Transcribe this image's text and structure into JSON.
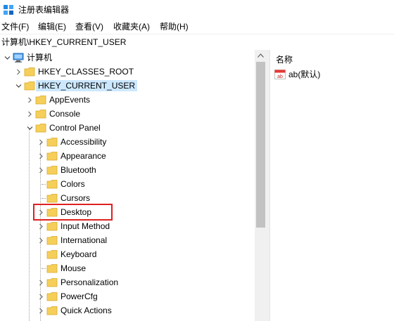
{
  "window": {
    "title": "注册表编辑器",
    "icon": "regedit-icon"
  },
  "menu": [
    "文件(F)",
    "编辑(E)",
    "查看(V)",
    "收藏夹(A)",
    "帮助(H)"
  ],
  "address": "计算机\\HKEY_CURRENT_USER",
  "tree": {
    "root": "计算机",
    "hkcr": "HKEY_CLASSES_ROOT",
    "hkcu": "HKEY_CURRENT_USER",
    "hkcu_children": [
      "AppEvents",
      "Console",
      "Control Panel"
    ],
    "control_panel_children": [
      "Accessibility",
      "Appearance",
      "Bluetooth",
      "Colors",
      "Cursors",
      "Desktop",
      "Input Method",
      "International",
      "Keyboard",
      "Mouse",
      "Personalization",
      "PowerCfg",
      "Quick Actions"
    ],
    "highlighted": "Desktop"
  },
  "values_pane": {
    "column_name": "名称",
    "rows": [
      "ab(默认)"
    ]
  },
  "colors": {
    "selection": "#cce8ff",
    "highlight_box": "#e02020",
    "folder": "#f5cf5a"
  }
}
